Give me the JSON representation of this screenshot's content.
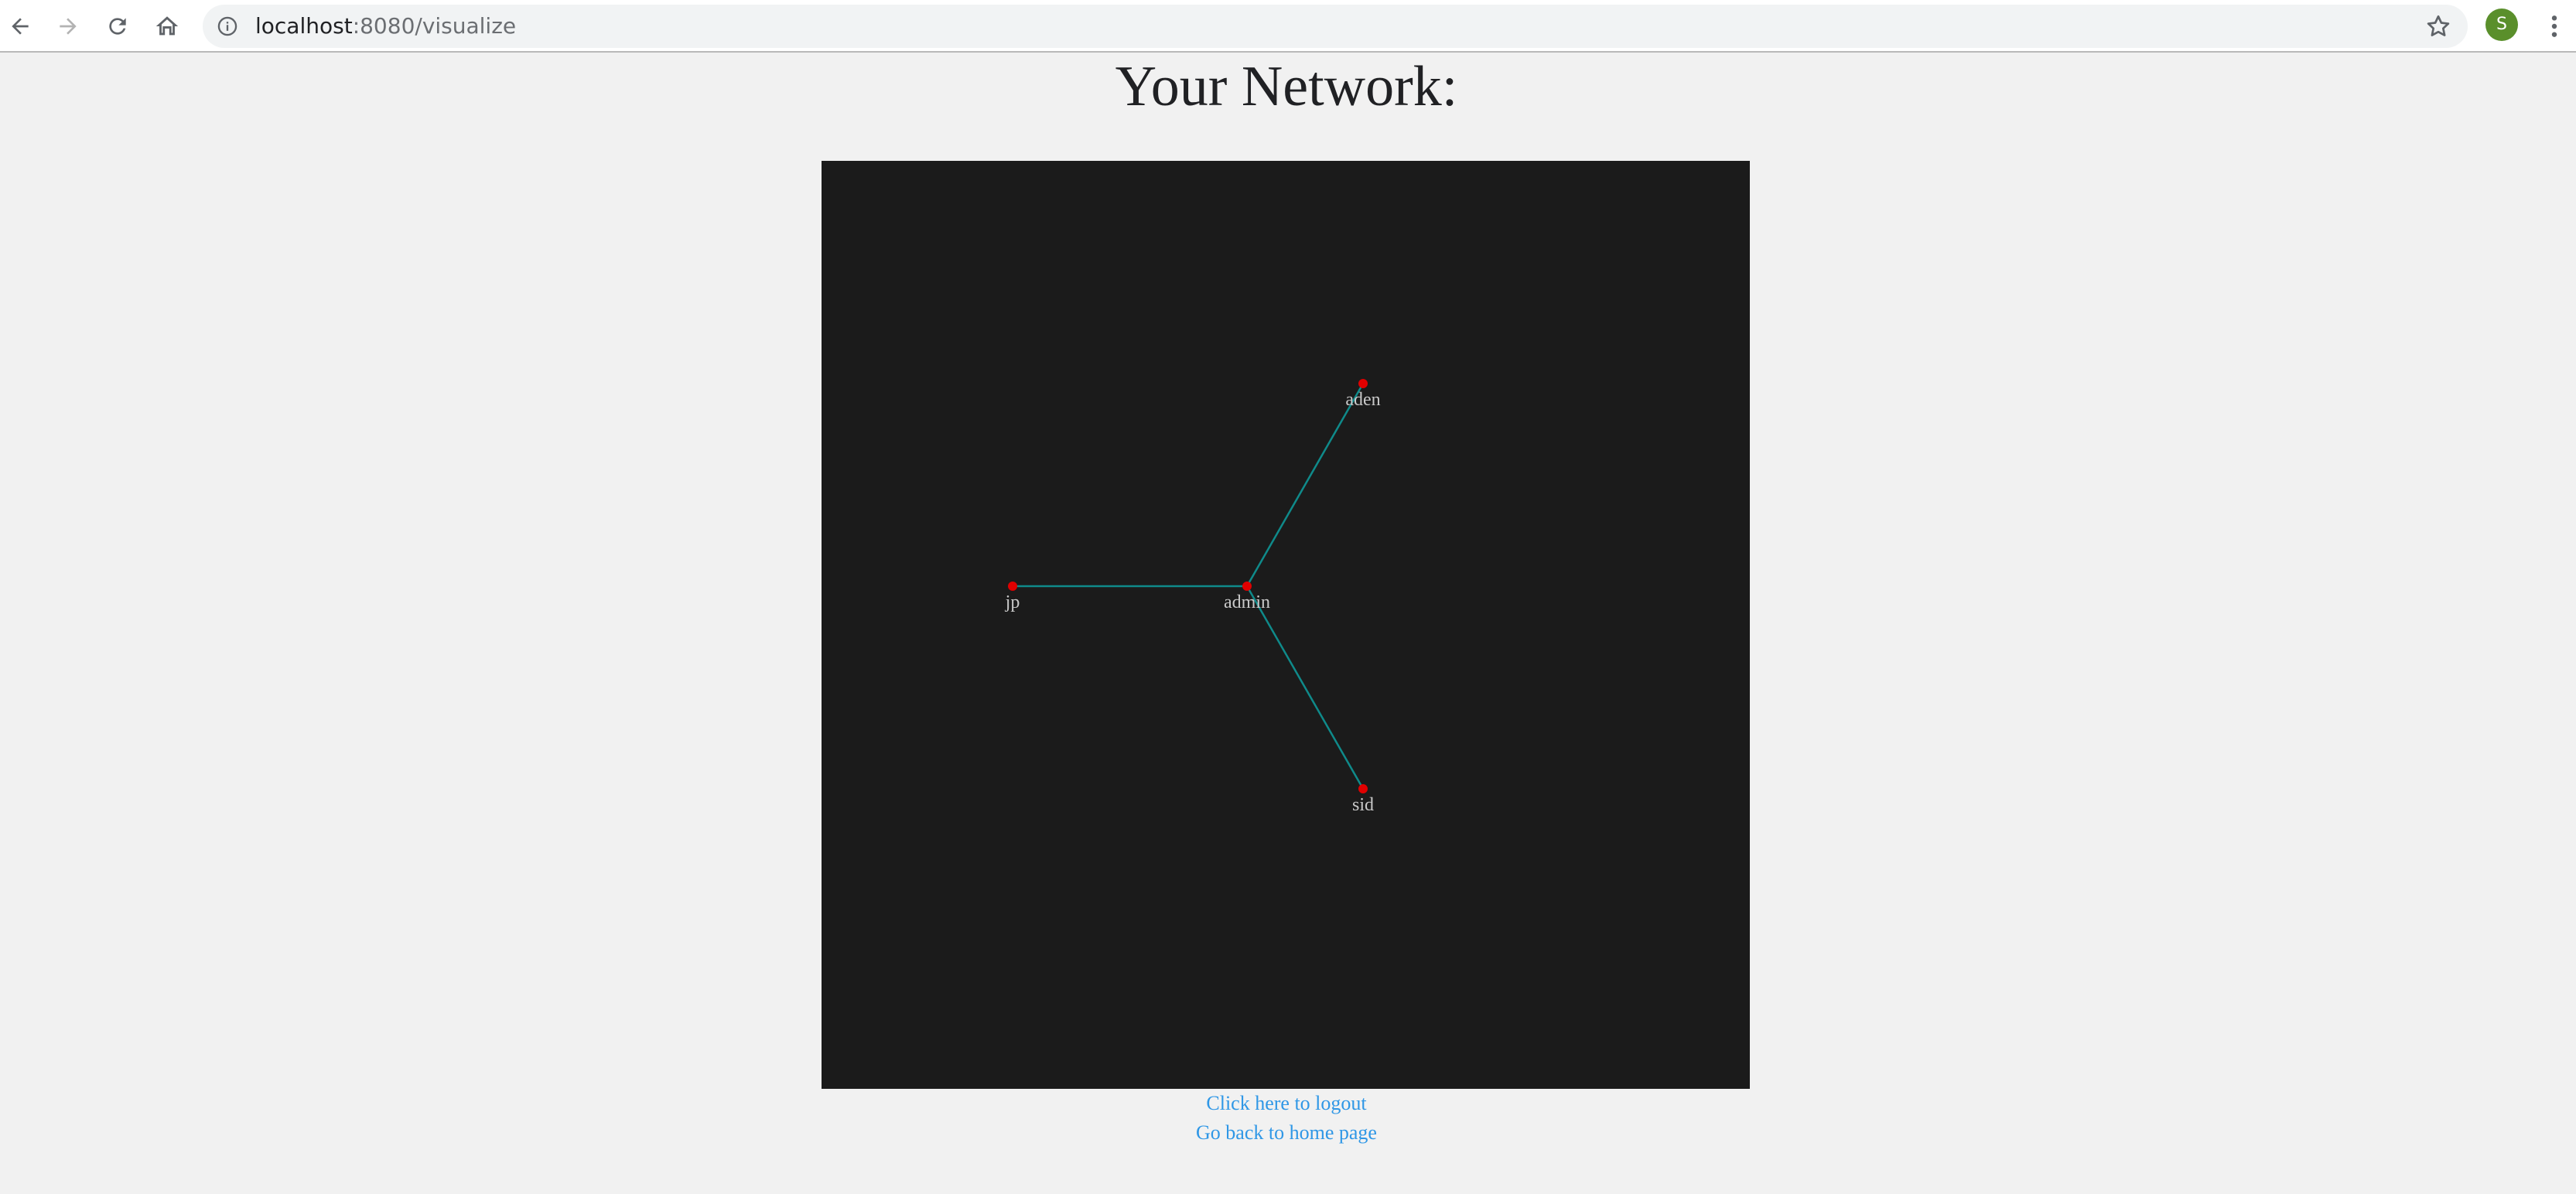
{
  "browser": {
    "url_host": "localhost",
    "url_rest": ":8080/visualize",
    "profile_initial": "S",
    "icons": [
      "back-icon",
      "forward-icon",
      "reload-icon",
      "home-icon",
      "info-icon",
      "bookmark-star-icon",
      "menu-icon"
    ]
  },
  "page": {
    "title": "Your Network:",
    "logout_link": "Click here to logout",
    "home_link": "Go back to home page"
  },
  "colors": {
    "panel_background": "#1b1b1b",
    "node": "#e00000",
    "edge": "#0f8a8a",
    "label": "#c9c9c9",
    "link": "#2f97e6"
  },
  "network": {
    "nodes": [
      {
        "id": "admin",
        "label": "admin"
      },
      {
        "id": "aden",
        "label": "aden"
      },
      {
        "id": "jp",
        "label": "jp"
      },
      {
        "id": "sid",
        "label": "sid"
      }
    ],
    "edges": [
      {
        "source": "admin",
        "target": "aden"
      },
      {
        "source": "admin",
        "target": "jp"
      },
      {
        "source": "admin",
        "target": "sid"
      }
    ]
  }
}
